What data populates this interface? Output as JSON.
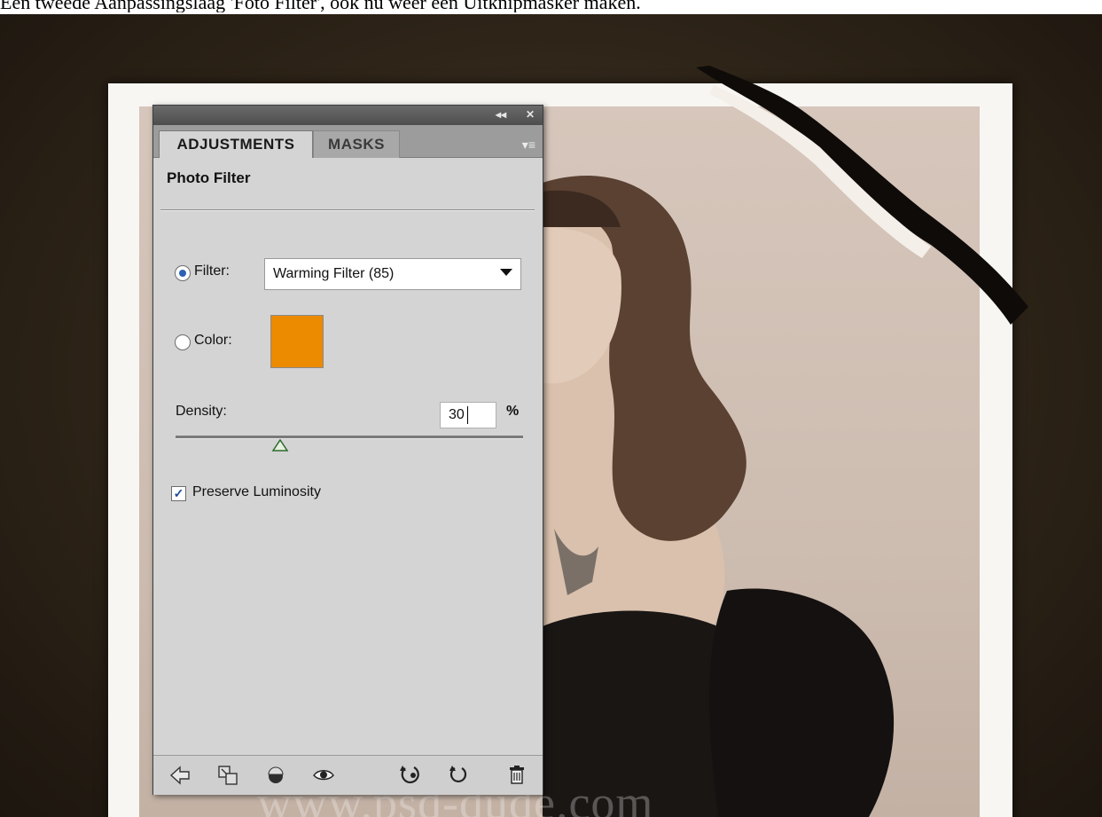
{
  "caption": "Een tweede Aanpassingslaag 'Foto Filter', ook nu weer een Uitknipmasker maken.",
  "panel": {
    "collapse_glyph": "◂◂",
    "close_glyph": "✕",
    "tabs": [
      {
        "label": "ADJUSTMENTS",
        "active": true
      },
      {
        "label": "MASKS",
        "active": false
      }
    ],
    "menu_glyph": "▾≡",
    "title": "Photo Filter",
    "filter": {
      "label": "Filter:",
      "selected": true,
      "value": "Warming Filter (85)"
    },
    "color": {
      "label": "Color:",
      "selected": false,
      "swatch": "#ec8a00"
    },
    "density": {
      "label": "Density:",
      "value": "30",
      "unit": "%",
      "slider_fraction": 0.3
    },
    "preserve_luminosity": {
      "label": "Preserve Luminosity",
      "checked": true
    },
    "bottom_icons": [
      "back-arrow-icon",
      "clip-layer-icon",
      "view-previous-state-icon",
      "eye-icon",
      "reset-icon",
      "refresh-icon",
      "trash-icon"
    ]
  },
  "watermark": "www.psd-dude.com",
  "colors": {
    "accent_swatch": "#ec8a00",
    "radio_selected": "#2a63b5"
  }
}
